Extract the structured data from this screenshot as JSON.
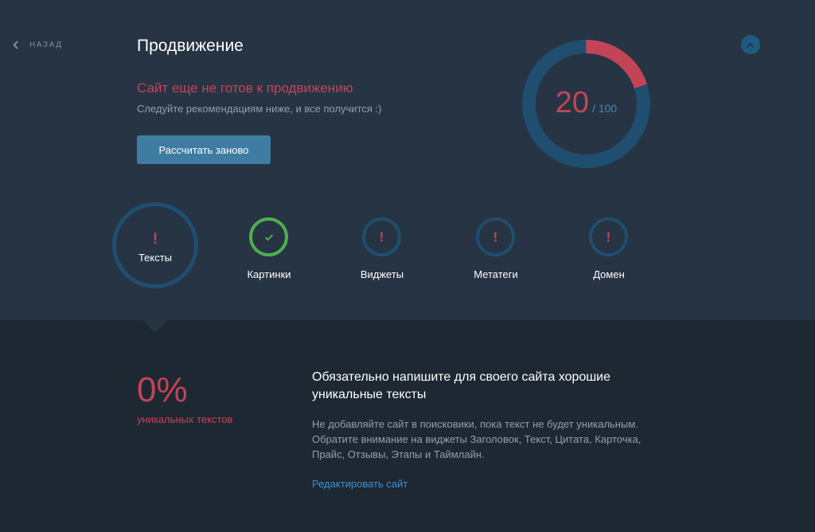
{
  "nav": {
    "back_label": "НАЗАД"
  },
  "header": {
    "title": "Продвижение",
    "warning": "Сайт еще не готов к продвижению",
    "subtitle": "Следуйте рекомендациям ниже, и все получится :)",
    "recalc_label": "Рассчитать заново"
  },
  "score": {
    "value": "20",
    "max_label": "/ 100",
    "fraction": 0.2
  },
  "steps": [
    {
      "label": "Тексты",
      "status": "warning",
      "mark": "!"
    },
    {
      "label": "Картинки",
      "status": "ok",
      "mark": "✓"
    },
    {
      "label": "Виджеты",
      "status": "warning",
      "mark": "!"
    },
    {
      "label": "Метатеги",
      "status": "warning",
      "mark": "!"
    },
    {
      "label": "Домен",
      "status": "warning",
      "mark": "!"
    }
  ],
  "detail": {
    "percent": "0%",
    "percent_label": "уникальных текстов",
    "heading": "Обязательно напишите для своего сайта хорошие уникальные тексты",
    "description": "Не добавляйте сайт в поисковики, пока текст не будет уникальным. Обратите внимание на виджеты Заголовок, Текст, Цитата, Карточка, Прайс, Отзывы, Этапы и Таймлайн.",
    "link_label": "Редактировать сайт"
  },
  "colors": {
    "top_bg": "#263444",
    "bottom_bg": "#1e2832",
    "accent_red": "#c44457",
    "accent_blue": "#1f4e6f",
    "ok_green": "#4dae50",
    "button": "#3e7ca2",
    "link": "#3d8fd6"
  }
}
